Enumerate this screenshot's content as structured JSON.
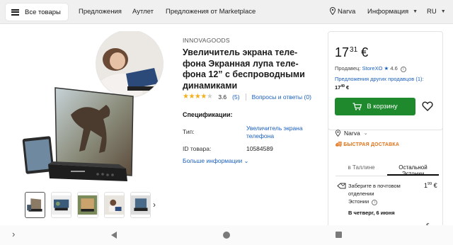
{
  "nav": {
    "all_products": "Все товары",
    "links": [
      "Предложения",
      "Аутлет",
      "Предложения от Marketplace"
    ],
    "location": "Narva",
    "info": "Информация",
    "language": "RU"
  },
  "product": {
    "brand": "INNOVAGOODS",
    "title_lines": [
      "Увеличитель экрана теле-",
      "фона Экранная лупа теле-",
      "фона 12” с беспроводными",
      "динамиками"
    ],
    "rating": "3.6",
    "rating_stars": 3.6,
    "reviews": "(5)",
    "qa": "Вопросы и ответы (0)",
    "spec_header": "Спецификации:",
    "spec_type_label": "Тип:",
    "spec_type_value_lines": [
      "Увеличитель экрана",
      "телефона"
    ],
    "spec_id_label": "ID товара:",
    "spec_id_value": "10584589",
    "more_info": "Больше информации"
  },
  "buy": {
    "price_main": "17",
    "price_cents": "31",
    "currency": "€",
    "seller_label": "Продавец:",
    "seller_name": "StoreXO",
    "seller_rating": "4.6",
    "other_offers": "Предложения других продавцов (1):",
    "other_price_main": "17",
    "other_price_cents": "49",
    "other_currency": "€",
    "cart_button": "В корзину"
  },
  "delivery": {
    "location": "Narva",
    "fast": "БЫСТРАЯ ДОСТАВКА",
    "tabs": [
      "в Таллине",
      "Остальной Эстонии"
    ],
    "active_tab": 1,
    "pickup_lines": [
      "Заберите в почтовом",
      "отделении",
      "Эстонии"
    ],
    "pickup_when": "В четверг, 6 июня",
    "pickup_price_main": "1",
    "pickup_price_cents": "99",
    "pickup_currency": "€",
    "next_price": "€"
  },
  "colors": {
    "accent_blue": "#1a5fc0",
    "cart_green": "#1f8a2d",
    "star_yellow": "#f2b01e",
    "fast_orange": "#e1731a"
  }
}
